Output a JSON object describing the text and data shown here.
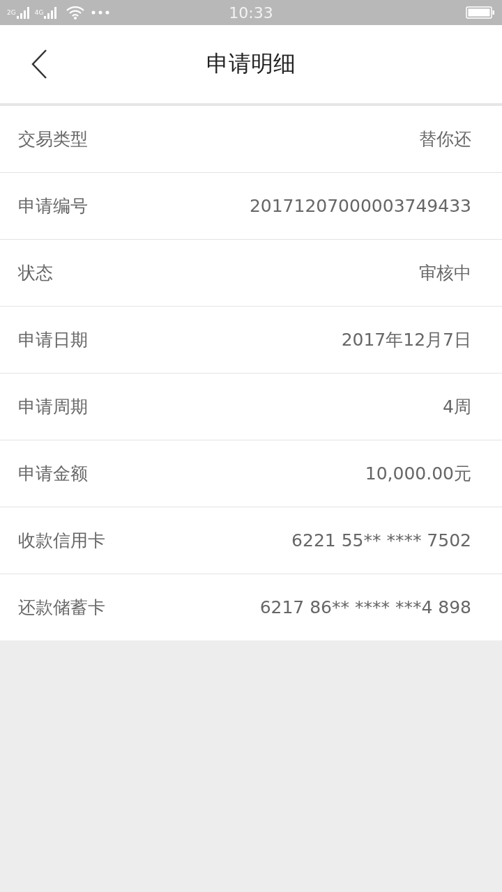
{
  "status_bar": {
    "networks": [
      "2G",
      "4G"
    ],
    "time": "10:33"
  },
  "header": {
    "title": "申请明细"
  },
  "rows": [
    {
      "label": "交易类型",
      "value": "替你还"
    },
    {
      "label": "申请编号",
      "value": "20171207000003749433"
    },
    {
      "label": "状态",
      "value": "审核中"
    },
    {
      "label": "申请日期",
      "value": "2017年12月7日"
    },
    {
      "label": "申请周期",
      "value": "4周"
    },
    {
      "label": "申请金额",
      "value": "10,000.00元"
    },
    {
      "label": "收款信用卡",
      "value": "6221 55** **** 7502"
    },
    {
      "label": "还款储蓄卡",
      "value": "6217 86** **** ***4 898"
    }
  ]
}
